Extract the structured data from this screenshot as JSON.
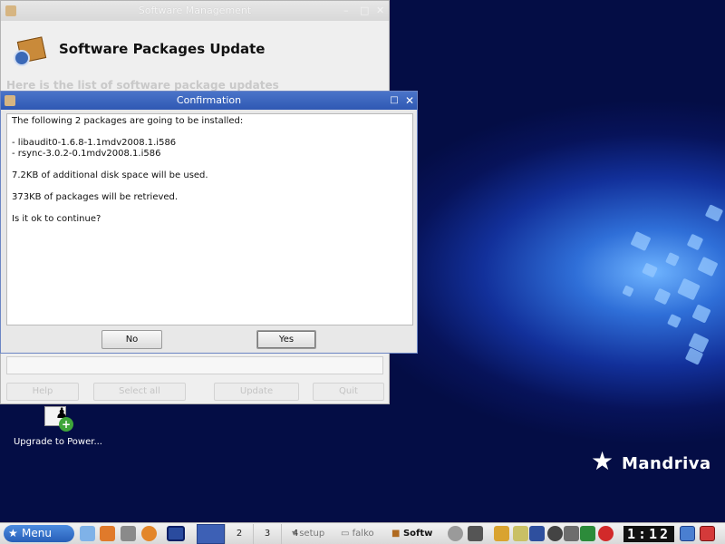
{
  "desktop": {
    "brand": "Mandriva",
    "icons": [
      {
        "label": "Upgrade to Power..."
      }
    ]
  },
  "background_window": {
    "title": "Software Management",
    "header_title": "Software Packages Update",
    "subtitle": "Here is the list of software package updates",
    "buttons": {
      "help": "Help",
      "select_all": "Select all",
      "update": "Update",
      "quit": "Quit"
    }
  },
  "dialog": {
    "title": "Confirmation",
    "intro": "The following 2 packages are going to be installed:",
    "packages": [
      "- libaudit0-1.6.8-1.1mdv2008.1.i586",
      "- rsync-3.0.2-0.1mdv2008.1.i586"
    ],
    "disk_space": "7.2KB of additional disk space will be used.",
    "retrieved": "373KB of packages will be retrieved.",
    "question": "Is it ok to continue?",
    "buttons": {
      "no": "No",
      "yes": "Yes"
    }
  },
  "taskbar": {
    "menu_label": "Menu",
    "pager": [
      "1",
      "2",
      "3",
      "4"
    ],
    "tasks": [
      "setup",
      "falko",
      "Softw"
    ],
    "clock": "1:12"
  },
  "colors": {
    "desktop_dark": "#050e4a",
    "desktop_glow": "#6fb4ff",
    "dialog_titlebar": "#2f58b3",
    "menu_button": "#275fb8"
  }
}
